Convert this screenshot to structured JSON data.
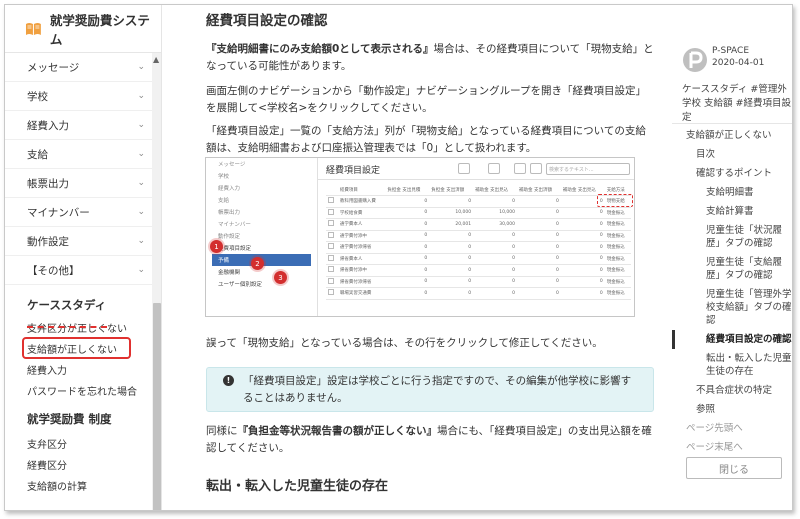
{
  "sidebar": {
    "title": "就学奨励費システム",
    "items": [
      {
        "label": "メッセージ"
      },
      {
        "label": "学校"
      },
      {
        "label": "経費入力"
      },
      {
        "label": "支給"
      },
      {
        "label": "帳票出力"
      },
      {
        "label": "マイナンバー"
      },
      {
        "label": "動作設定"
      },
      {
        "label": "【その他】"
      }
    ],
    "case_study_title": "ケーススタディ",
    "case_items": [
      {
        "label": "支弁区分が正しくない"
      },
      {
        "label": "支給額が正しくない"
      },
      {
        "label": "経費入力"
      },
      {
        "label": "パスワードを忘れた場合"
      }
    ],
    "system_title": "就学奨励費 制度",
    "system_items": [
      {
        "label": "支弁区分"
      },
      {
        "label": "経費区分"
      },
      {
        "label": "支給額の計算"
      }
    ]
  },
  "main": {
    "title": "経費項目設定の確認",
    "p1_bold": "『支給明細書にのみ支給額0として表示される』",
    "p1_rest": "場合は、その経費項目について「現物支給」となっている可能性があります。",
    "p2": "画面左側のナビゲーションから「動作設定」ナビゲーショングループを開き「経費項目設定」を展開して<学校名>をクリックしてください。",
    "p3": "「経費項目設定」一覧の「支給方法」列が「現物支給」となっている経費項目についての支給額は、支給明細書および口座振込管理表では「0」として扱われます。",
    "p4": "誤って「現物支給」となっている場合は、その行をクリックして修正してください。",
    "note": "「経費項目設定」設定は学校ごとに行う指定ですので、その編集が他学校に影響することはありません。",
    "p5_pre": "同様に",
    "p5_bold": "『負担金等状況報告書の額が正しくない』",
    "p5_rest": "場合にも、「経費項目設定」の支出見込額を確認してください。",
    "h3": "転出・転入した児童生徒の存在"
  },
  "screenshot": {
    "title": "経費項目設定",
    "search_placeholder": "検索するテキスト...",
    "side_items": [
      {
        "label": "メッセージ",
        "style": ""
      },
      {
        "label": "学校",
        "style": ""
      },
      {
        "label": "経費入力",
        "style": ""
      },
      {
        "label": "支給",
        "style": ""
      },
      {
        "label": "帳票出力",
        "style": ""
      },
      {
        "label": "マイナンバー",
        "style": ""
      },
      {
        "label": "動作設定",
        "style": ""
      },
      {
        "label": "経費項目設定",
        "style": "dark"
      },
      {
        "label": "予備",
        "style": "sel"
      },
      {
        "label": "金融機関",
        "style": "dark"
      },
      {
        "label": "ユーザー個別設定",
        "style": "dark"
      }
    ],
    "headers": [
      "",
      "経費項目",
      "負担金 支出見積",
      "負担金 支出済額",
      "補助金 支出見込",
      "補助金 支出済額",
      "補助金 支出見込",
      "支給方法"
    ],
    "rows": [
      [
        "",
        "教科用図書購入費",
        "0",
        "0",
        "0",
        "0",
        "0",
        "現物支給"
      ],
      [
        "",
        "学校給食費",
        "0",
        "10,000",
        "10,000",
        "0",
        "0",
        "現金振込"
      ],
      [
        "",
        "通学費本人",
        "0",
        "20,001",
        "30,000",
        "0",
        "0",
        "現金振込"
      ],
      [
        "",
        "通学費付添中",
        "0",
        "0",
        "0",
        "0",
        "0",
        "現金振込"
      ],
      [
        "",
        "通学費付添帰省",
        "0",
        "0",
        "0",
        "0",
        "0",
        "現金振込"
      ],
      [
        "",
        "帰省費本人",
        "0",
        "0",
        "0",
        "0",
        "0",
        "現金振込"
      ],
      [
        "",
        "帰省費付添中",
        "0",
        "0",
        "0",
        "0",
        "0",
        "現金振込"
      ],
      [
        "",
        "帰省費付添帰省",
        "0",
        "0",
        "0",
        "0",
        "0",
        "現金振込"
      ],
      [
        "",
        "職場実習交通費",
        "0",
        "0",
        "0",
        "0",
        "0",
        "現金振込"
      ]
    ],
    "badges": [
      "1",
      "2",
      "3"
    ]
  },
  "right": {
    "brand": "P-SPACE",
    "date": "2020-04-01",
    "tags": "ケーススタディ #管理外学校 支給額 #経費項目設定",
    "toc": [
      {
        "label": "支給額が正しくない",
        "level": "l1",
        "state": ""
      },
      {
        "label": "目次",
        "level": "l2",
        "state": ""
      },
      {
        "label": "確認するポイント",
        "level": "l2",
        "state": ""
      },
      {
        "label": "支給明細書",
        "level": "l3",
        "state": ""
      },
      {
        "label": "支給計算書",
        "level": "l3",
        "state": ""
      },
      {
        "label": "児童生徒「状況履歴」タブの確認",
        "level": "l3",
        "state": ""
      },
      {
        "label": "児童生徒「支給履歴」タブの確認",
        "level": "l3",
        "state": ""
      },
      {
        "label": "児童生徒「管理外学校支給額」タブの確認",
        "level": "l3",
        "state": ""
      },
      {
        "label": "経費項目設定の確認",
        "level": "l3",
        "state": "active"
      },
      {
        "label": "転出・転入した児童生徒の存在",
        "level": "l3",
        "state": ""
      },
      {
        "label": "不具合症状の特定",
        "level": "l2",
        "state": ""
      },
      {
        "label": "参照",
        "level": "l2",
        "state": ""
      },
      {
        "label": "ページ先頭へ",
        "level": "l1",
        "state": "muted"
      },
      {
        "label": "ページ末尾へ",
        "level": "l1",
        "state": "muted"
      }
    ],
    "close_label": "閉じる"
  }
}
